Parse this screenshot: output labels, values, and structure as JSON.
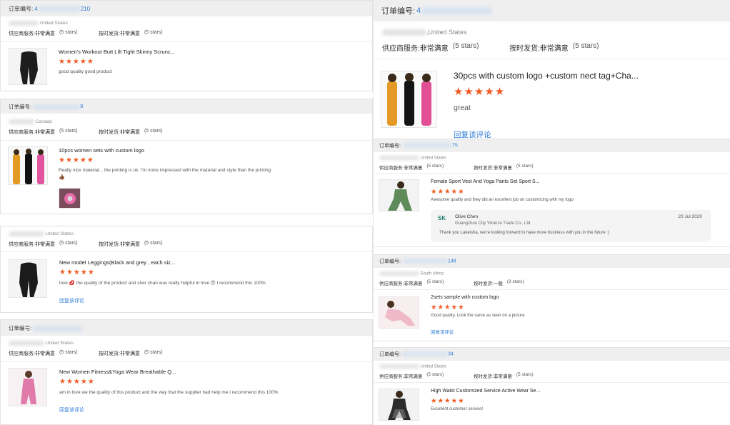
{
  "labels": {
    "order_no": "订单编号:",
    "supplier_service": "供应商服务:",
    "on_time_shipping": "按时发货:",
    "reply_link": "回复该评论"
  },
  "colors": {
    "accent_blue": "#2b7bd6",
    "star_orange": "#f05a22",
    "header_bg": "#efefef"
  },
  "left": [
    {
      "order_prefix": "4",
      "order_suffix": "210",
      "country": "United States",
      "supplier_value": "非常满意",
      "supplier_stars": "(5 stars)",
      "shipping_value": "非常满意",
      "shipping_stars": "(5 stars)",
      "product_title": "Women's Workout Butt Lift Tight Skinny Scrunc...",
      "stars": "★★★★★",
      "review": "good quality good product"
    },
    {
      "order_prefix": "",
      "order_suffix": "9",
      "country": "Canada",
      "supplier_value": "非常满意",
      "supplier_stars": "(5 stars)",
      "shipping_value": "非常满意",
      "shipping_stars": "(5 stars)",
      "product_title": "10pcs women sets with custom logo",
      "stars": "★★★★★",
      "review": "Really nice material... the printing is ok. I'm more impressed with the material and style than the printing",
      "review_emoji": "👍🏾"
    },
    {
      "country": "United States",
      "supplier_value": "非常满意",
      "supplier_stars": "(5 stars)",
      "shipping_value": "非常满意",
      "shipping_stars": "(5 stars)",
      "product_title": "New model Leggings(Black and grey , each siz...",
      "stars": "★★★★★",
      "review_a": "love",
      "review_emoji_a": "💋",
      "review_b": "the quality of the product and sher chan was really helpful in love",
      "review_emoji_b": "😍",
      "review_c": "I recommend this 100%",
      "reply": "回复该评论"
    },
    {
      "order_prefix": "",
      "order_suffix": "",
      "country": "United States",
      "supplier_value": "非常满意",
      "supplier_stars": "(5 stars)",
      "shipping_value": "非常满意",
      "shipping_stars": "(5 stars)",
      "product_title": "New Women Fitness&Yoga Wear Breathable Q...",
      "stars": "★★★★★",
      "review": "am in love we the quality of this product and the way that the supplier had help me I recommend this 100%",
      "reply": "回复该评论"
    }
  ],
  "right": [
    {
      "order_prefix": "4",
      "order_suffix": "",
      "country": ",United States",
      "supplier_value": "非常满意",
      "supplier_stars": "(5 stars)",
      "shipping_value": "非常满意",
      "shipping_stars": "(5 stars)",
      "product_title": "30pcs with custom logo +custom nect tag+Cha...",
      "stars": "★★★★★",
      "review": "great",
      "reply": "回复该评论"
    },
    {
      "order_prefix": "",
      "order_suffix": "75",
      "country": "United States",
      "supplier_value": "非常满意",
      "supplier_stars": "(5 stars)",
      "shipping_value": "非常满意",
      "shipping_stars": "(5 stars)",
      "product_title": "Female Sport Vest And Yoga Pants Set Sport S...",
      "stars": "★★★★★",
      "review": "Awesome quality and they did an excellent job on customizing with my logo",
      "supplier_reply": {
        "logo": "SK",
        "name": "Olive Chen",
        "company": "Guangzhou City Yikunze Trade Co., Ltd.",
        "date": "20 Jul 2020",
        "text": "Thank you Lakeisha, we're looking forward to have more business with you in the future :)"
      }
    },
    {
      "order_prefix": "",
      "order_suffix": "148",
      "country": "South Africa",
      "supplier_value": "非常满意",
      "supplier_stars": "(5 stars)",
      "shipping_value": "一般",
      "shipping_stars": "(3 stars)",
      "product_title": "2sets sample with custom logo",
      "stars": "★★★★★",
      "review": "Good quality. Look the same as seen on a picture",
      "reply": "回复该评论"
    },
    {
      "order_prefix": "",
      "order_suffix": "34",
      "country": "United States",
      "supplier_value": "非常满意",
      "supplier_stars": "(5 stars)",
      "shipping_value": "非常满意",
      "shipping_stars": "(5 stars)",
      "product_title": "High Waist Customized Service Active Wear Se...",
      "stars": "★★★★★",
      "review": "Excellent customer service!"
    }
  ]
}
